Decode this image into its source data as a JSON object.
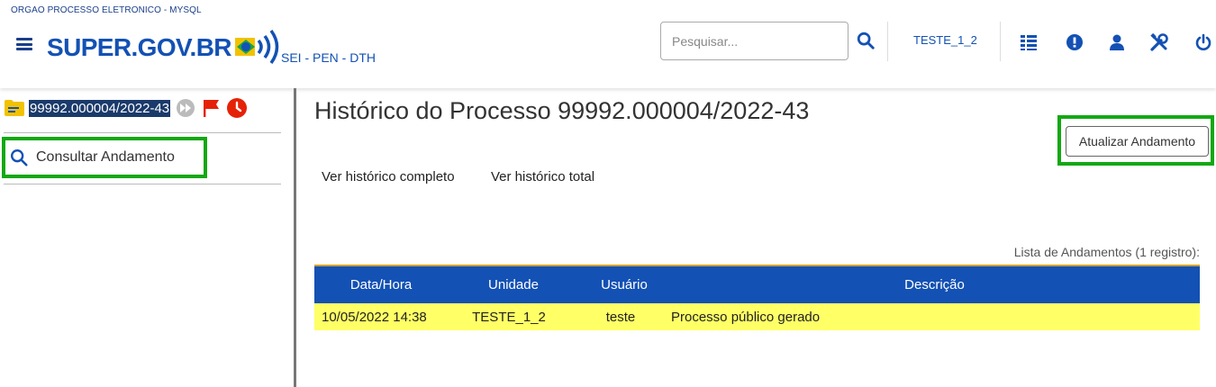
{
  "header": {
    "org": "ORGAO PROCESSO ELETRONICO - MYSQL",
    "logo_text": "SUPER.GOV.BR",
    "subtitle": "SEI - PEN - DTH",
    "search_placeholder": "Pesquisar...",
    "unit": "TESTE_1_2",
    "icons": [
      "menu-icon",
      "search-icon",
      "control-panel-icon",
      "alert-icon",
      "user-icon",
      "tools-icon",
      "power-icon"
    ]
  },
  "left": {
    "process_number": "99992.000004/2022-43",
    "consult_label": "Consultar Andamento"
  },
  "main": {
    "title": "Histórico do Processo 99992.000004/2022-43",
    "update_button": "Atualizar Andamento",
    "links": [
      "Ver histórico completo",
      "Ver histórico total"
    ],
    "caption": "Lista de Andamentos (1 registro):",
    "columns": [
      "Data/Hora",
      "Unidade",
      "Usuário",
      "Descrição"
    ],
    "rows": [
      {
        "datetime": "10/05/2022 14:38",
        "unit": "TESTE_1_2",
        "user": "teste",
        "description": "Processo público gerado"
      }
    ]
  },
  "colors": {
    "brand_blue": "#1351b4",
    "table_header": "#1351b4",
    "row_highlight": "#ffff66",
    "focus_frame": "#13a813",
    "flag_red": "#e52207"
  }
}
